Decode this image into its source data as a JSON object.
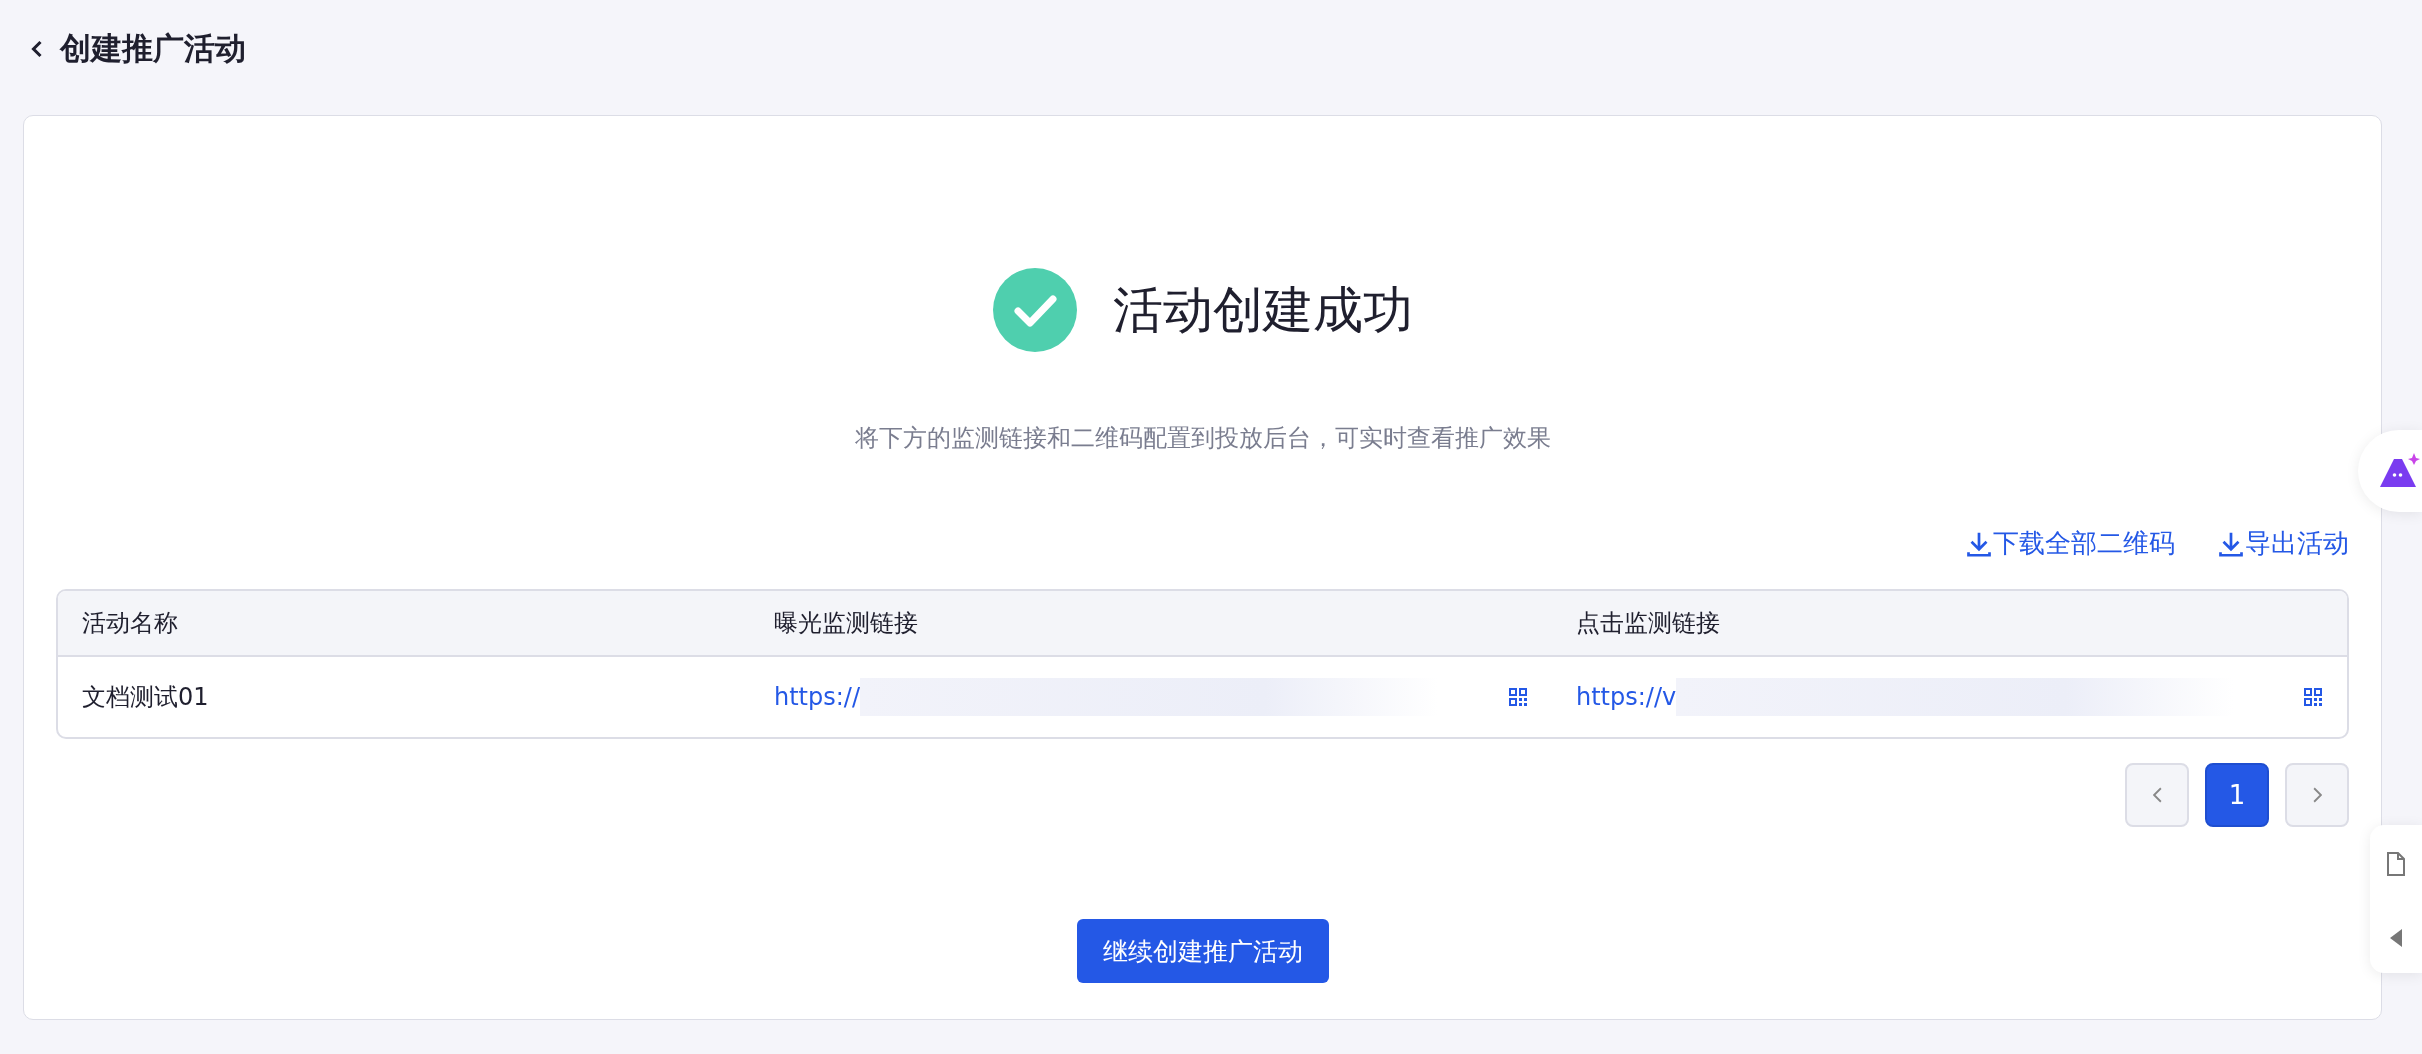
{
  "header": {
    "title": "创建推广活动"
  },
  "result": {
    "success": true,
    "title": "活动创建成功",
    "description": "将下方的监测链接和二维码配置到投放后台，可实时查看推广效果"
  },
  "actions": [
    {
      "label": "下载全部二维码"
    },
    {
      "label": "导出活动"
    }
  ],
  "table": {
    "columns": [
      "活动名称",
      "曝光监测链接",
      "点击监测链接"
    ],
    "rows": [
      {
        "name": "文档测试01",
        "impression_link": "https://",
        "click_link": "https://v"
      }
    ]
  },
  "pagination": {
    "pages": [
      {
        "label": "1",
        "selected": true
      }
    ]
  },
  "primary_button": "继续创建推广活动"
}
